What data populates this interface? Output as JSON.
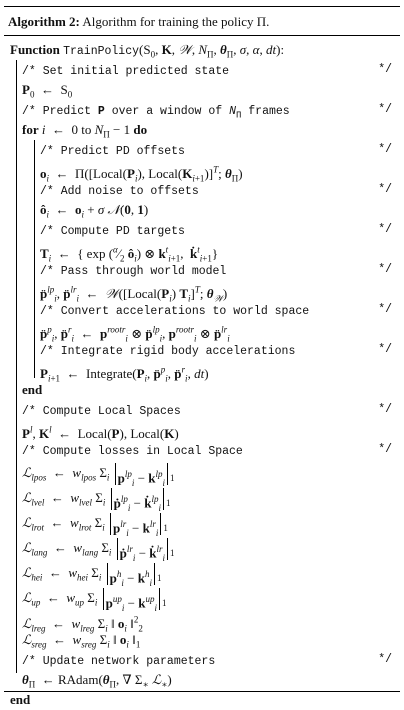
{
  "header": {
    "label": "Algorithm 2:",
    "caption": "Algorithm for training the policy Π."
  },
  "lines": [
    {
      "indent": 0,
      "code": "",
      "html": "<span class='kw'>Function</span> <span class='mono'>TrainPolicy</span>(S<sub>0</sub>, <b>K</b>, <i>𝒲</i>, <i>N</i><sub>Π</sub>, <b><i>θ</i></b><sub>Π</sub>, <i>σ</i>, <i>α</i>, <i>dt</i>):"
    },
    {
      "indent": 1,
      "code": "/* Set initial predicted state",
      "end": "*/"
    },
    {
      "indent": 1,
      "html": "<b>P</b><sub>0</sub> &nbsp;← &nbsp;S<sub>0</sub>"
    },
    {
      "indent": 1,
      "code": "/* Predict <b>P</b> over a window of <i>N</i><sub>Π</sub> frames",
      "end": "*/"
    },
    {
      "indent": 1,
      "html": "<span class='kw'>for</span> <i>i</i> &nbsp;← &nbsp;0 to <i>N</i><sub>Π</sub> − 1 <span class='kw'>do</span>"
    },
    {
      "indent": 2,
      "code": "/* Predict PD offsets",
      "end": "*/"
    },
    {
      "indent": 2,
      "html": "<b>o</b><sub><i>i</i></sub> &nbsp;← &nbsp;Π([Local(<b>P</b><sub><i>i</i></sub>), Local(<b>K</b><sub><i>i</i>+1</sub>)]<sup><i>T</i></sup>; <b><i>θ</i></b><sub>Π</sub>)"
    },
    {
      "indent": 2,
      "code": "/* Add noise to offsets",
      "end": "*/"
    },
    {
      "indent": 2,
      "html": "<b>ô</b><sub><i>i</i></sub> &nbsp;← &nbsp;<b>o</b><sub><i>i</i></sub> + <i>σ</i> <i>𝒩</i>(<b>0</b>, <b>1</b>)"
    },
    {
      "indent": 2,
      "code": "/* Compute PD targets",
      "end": "*/"
    },
    {
      "indent": 2,
      "html": "<b>T</b><sub><i>i</i></sub> &nbsp;← &nbsp;{ exp (<sup><i>α</i></sup>⁄<sub>2</sub> <b>ô</b><sub><i>i</i></sub>) ⊗ <b>k</b><sup><i>t</i></sup><sub><i>i</i>+1</sub>, &nbsp;<b>k̇</b><sup><i>t</i></sup><sub><i>i</i>+1</sub>}"
    },
    {
      "indent": 2,
      "code": "/* Pass through world model",
      "end": "*/"
    },
    {
      "indent": 2,
      "html": "<b>p̈</b><sup><i>lp</i></sup><sub><i>i</i></sub>, <b>p̈</b><sup><i>lr</i></sup><sub><i>i</i></sub> &nbsp;← &nbsp;<i>𝒲</i>([Local(<b>P</b><sub><i>i</i></sub>) <b>T</b><sub><i>i</i></sub>]<sup><i>T</i></sup>; <b><i>θ</i></b><sub><i>𝒲</i></sub>)"
    },
    {
      "indent": 2,
      "code": "/* Convert accelerations to world space",
      "end": "*/"
    },
    {
      "indent": 2,
      "html": "<b>p̈</b><sup><i>p</i></sup><sub><i>i</i></sub>, <b>p̈</b><sup><i>r</i></sup><sub><i>i</i></sub> &nbsp;← &nbsp;<b>p</b><sup><i>rootr</i></sup><sub><i>i</i></sub> ⊗ <b>p̈</b><sup><i>lp</i></sup><sub><i>i</i></sub>, <b>p</b><sup><i>rootr</i></sup><sub><i>i</i></sub> ⊗ <b>p̈</b><sup><i>lr</i></sup><sub><i>i</i></sub>"
    },
    {
      "indent": 2,
      "code": "/* Integrate rigid body accelerations",
      "end": "*/"
    },
    {
      "indent": 2,
      "html": "<b>P</b><sub><i>i</i>+1</sub> &nbsp;← &nbsp;Integrate(<b>P</b><sub><i>i</i></sub>, <b>p̈</b><sup><i>p</i></sup><sub><i>i</i></sub>, <b>p̈</b><sup><i>r</i></sup><sub><i>i</i></sub>, <i>dt</i>)"
    },
    {
      "indent": 1,
      "html": "<span class='kw'>end</span>"
    },
    {
      "indent": 1,
      "code": "/* Compute Local Spaces",
      "end": "*/"
    },
    {
      "indent": 1,
      "html": "<b>P</b><sup><i>l</i></sup>, <b>K</b><sup><i>l</i></sup> &nbsp;← &nbsp;Local(<b>P</b>), Local(<b>K</b>)"
    },
    {
      "indent": 1,
      "code": "/* Compute losses in Local Space",
      "end": "*/"
    },
    {
      "indent": 1,
      "html": "<i>ℒ</i><sub><i>lpos</i></sub> &nbsp;← &nbsp;<i>w</i><sub><i>lpos</i></sub> Σ<sub><i>i</i></sub> <span class='norm'><b>p</b><sup><i>lp</i></sup><sub><i>i</i></sub> − <b>k</b><sup><i>lp</i></sup><sub><i>i</i></sub></span><span class='sub1'>1</span>",
      "tall": true
    },
    {
      "indent": 1,
      "html": "<i>ℒ</i><sub><i>lvel</i></sub> &nbsp;← &nbsp;<i>w</i><sub><i>lvel</i></sub> Σ<sub><i>i</i></sub> <span class='norm'><b>ṗ</b><sup><i>lp</i></sup><sub><i>i</i></sub> − <b>k̇</b><sup><i>lp</i></sup><sub><i>i</i></sub></span><span class='sub1'>1</span>",
      "tall": true
    },
    {
      "indent": 1,
      "html": "<i>ℒ</i><sub><i>lrot</i></sub> &nbsp;← &nbsp;<i>w</i><sub><i>lrot</i></sub> Σ<sub><i>i</i></sub> <span class='norm'><b>p</b><sup><i>lr</i></sup><sub><i>i</i></sub> − <b>k</b><sup><i>lr</i></sup><sub><i>i</i></sub></span><span class='sub1'>1</span>",
      "tall": true
    },
    {
      "indent": 1,
      "html": "<i>ℒ</i><sub><i>lang</i></sub> &nbsp;← &nbsp;<i>w</i><sub><i>lang</i></sub> Σ<sub><i>i</i></sub> <span class='norm'><b>ṗ</b><sup><i>lr</i></sup><sub><i>i</i></sub> − <b>k̇</b><sup><i>lr</i></sup><sub><i>i</i></sub></span><span class='sub1'>1</span>",
      "tall": true
    },
    {
      "indent": 1,
      "html": "<i>ℒ</i><sub><i>hei</i></sub> &nbsp;← &nbsp;<i>w</i><sub><i>hei</i></sub> Σ<sub><i>i</i></sub> <span class='norm'><b>p</b><sup><i>h</i></sup><sub><i>i</i></sub> − <b>k</b><sup><i>h</i></sup><sub><i>i</i></sub></span><span class='sub1'>1</span>",
      "tall": true
    },
    {
      "indent": 1,
      "html": "<i>ℒ</i><sub><i>up</i></sub> &nbsp;← &nbsp;<i>w</i><sub><i>up</i></sub> Σ<sub><i>i</i></sub> <span class='norm'><b>p</b><sup><i>up</i></sup><sub><i>i</i></sub> − <b>k</b><sup><i>up</i></sup><sub><i>i</i></sub></span><span class='sub1'>1</span>",
      "tall": true
    },
    {
      "indent": 1,
      "html": "<i>ℒ</i><sub><i>lreg</i></sub> &nbsp;← &nbsp;<i>w</i><sub><i>lreg</i></sub> Σ<sub><i>i</i></sub> ‖ <b>o</b><sub><i>i</i></sub> ‖<sup>2</sup><sub>2</sub>"
    },
    {
      "indent": 1,
      "html": "<i>ℒ</i><sub><i>sreg</i></sub> &nbsp;← &nbsp;<i>w</i><sub><i>sreg</i></sub> Σ<sub><i>i</i></sub> ‖ <b>o</b><sub><i>i</i></sub> ‖<sub>1</sub>"
    },
    {
      "indent": 1,
      "code": "/* Update network parameters",
      "end": "*/"
    },
    {
      "indent": 1,
      "html": "<b><i>θ</i></b><sub>Π</sub> &nbsp;← RAdam(<b><i>θ</i></b><sub>Π</sub>, ∇ Σ<sub>∗</sub> <i>ℒ</i><sub>∗</sub>)"
    },
    {
      "indent": 0,
      "html": "<span class='kw'>end</span>"
    }
  ]
}
